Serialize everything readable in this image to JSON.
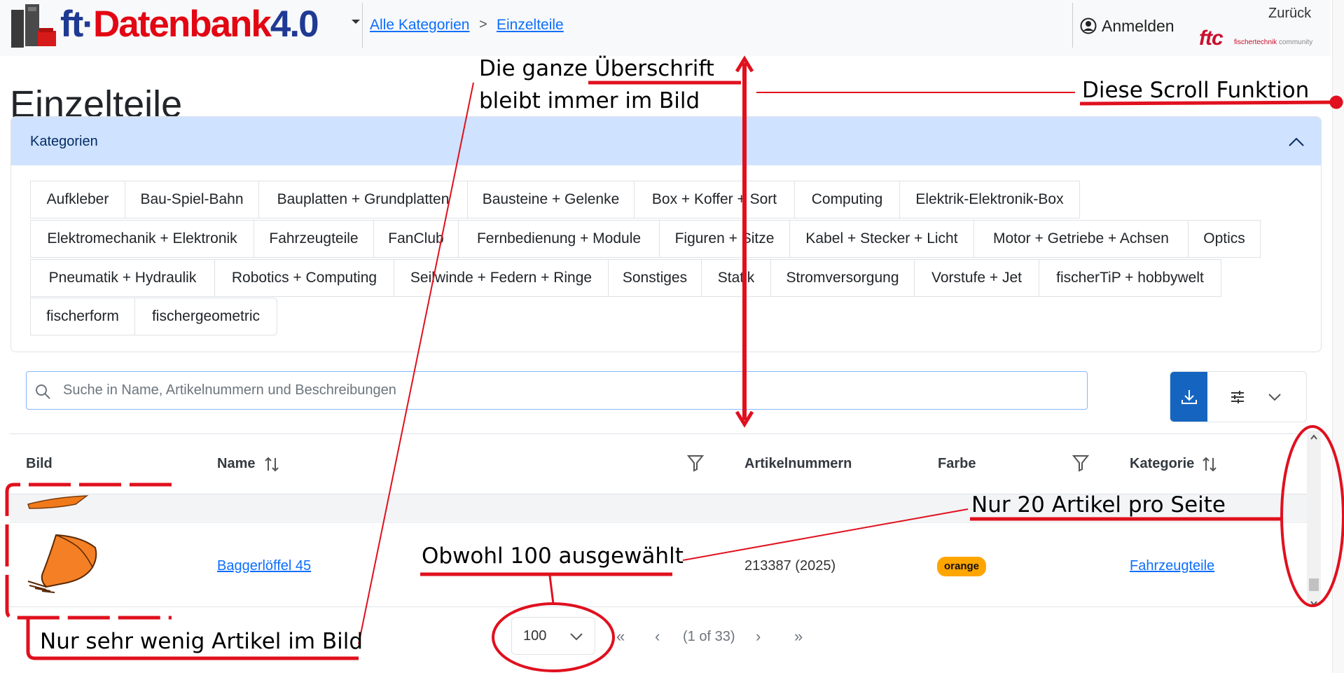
{
  "header": {
    "logo_text_ft": "ft·",
    "logo_text_main": "Datenbank",
    "logo_text_version": "4.0",
    "breadcrumb": [
      "Alle Kategorien",
      "Einzelteile"
    ],
    "breadcrumb_separator": ">",
    "login_label": "Anmelden",
    "back_label": "Zurück",
    "community_logo": "ftc",
    "community_brand_red": "fischertechnik",
    "community_brand_gray": "community"
  },
  "page": {
    "title": "Einzelteile"
  },
  "categories": {
    "label": "Kategorien",
    "items": [
      "Aufkleber",
      "Bau-Spiel-Bahn",
      "Bauplatten + Grundplatten",
      "Bausteine + Gelenke",
      "Box + Koffer + Sort",
      "Computing",
      "Elektrik-Elektronik-Box",
      "Elektromechanik + Elektronik",
      "Fahrzeugteile",
      "FanClub",
      "Fernbedienung + Module",
      "Figuren + Sitze",
      "Kabel + Stecker + Licht",
      "Motor + Getriebe + Achsen",
      "Optics",
      "Pneumatik + Hydraulik",
      "Robotics + Computing",
      "Seilwinde + Federn + Ringe",
      "Sonstiges",
      "Statik",
      "Stromversorgung",
      "Vorstufe + Jet",
      "fischerTiP + hobbywelt",
      "fischerform",
      "fischergeometric"
    ]
  },
  "search": {
    "placeholder": "Suche in Name, Artikelnummern und Beschreibungen",
    "value": ""
  },
  "table": {
    "headers": {
      "image": "Bild",
      "name": "Name",
      "article_numbers": "Artikelnummern",
      "color": "Farbe",
      "category": "Kategorie"
    },
    "rows": [
      {
        "name": "Baggerlöffel 45",
        "article_numbers": "213387 (2025)",
        "color": "orange",
        "category": "Fahrzeugteile"
      }
    ]
  },
  "paginator": {
    "rows_per_page": "100",
    "page_report": "(1 of 33)"
  },
  "annotations": {
    "heading_note_a": "Die ganze Überschrift",
    "heading_note_b": "bleibt immer im Bild",
    "scroll_note": "Diese Scroll Funktion",
    "per_page_note": "Nur 20 Artikel pro Seite",
    "selected_note": "Obwohl 100 ausgewählt",
    "few_items_note": "Nur sehr wenig Artikel im Bild"
  },
  "colors": {
    "logo_red": "#e30613",
    "logo_blue": "#1f3a93",
    "link_blue": "#0d6efd",
    "category_header_bg": "#cfe2ff",
    "primary_button": "#1565c0",
    "badge_orange": "#ffa500",
    "annotation_red": "#e0101e"
  },
  "icons": [
    "fischertechnik-brick-logo",
    "user-circle-icon",
    "chevron-up-icon",
    "search-icon",
    "download-icon",
    "sliders-icon",
    "chevron-down-icon",
    "sort-icon",
    "filter-icon",
    "first-page-icon",
    "prev-page-icon",
    "next-page-icon",
    "last-page-icon"
  ]
}
